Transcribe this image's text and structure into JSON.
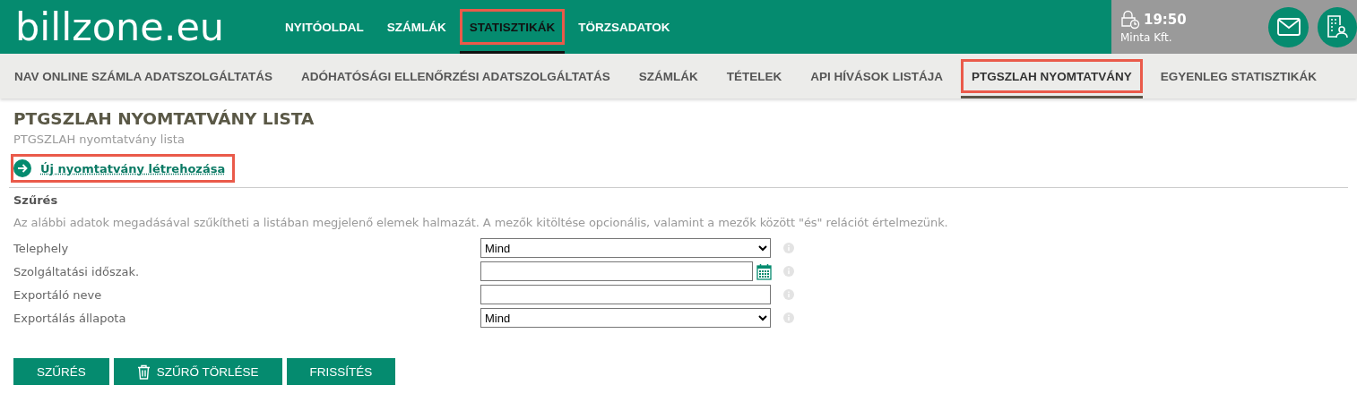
{
  "logo": "billzone.eu",
  "main_nav": [
    {
      "label": "NYITÓOLDAL",
      "selected": false,
      "highlighted": false
    },
    {
      "label": "SZÁMLÁK",
      "selected": false,
      "highlighted": false
    },
    {
      "label": "STATISZTIKÁK",
      "selected": true,
      "highlighted": true
    },
    {
      "label": "TÖRZSADATOK",
      "selected": false,
      "highlighted": false
    }
  ],
  "session": {
    "time": "19:50",
    "company": "Minta Kft."
  },
  "sub_nav": [
    {
      "label": "NAV ONLINE SZÁMLA ADATSZOLGÁLTATÁS",
      "selected": false,
      "highlighted": false
    },
    {
      "label": "ADÓHATÓSÁGI ELLENŐRZÉSI ADATSZOLGÁLTATÁS",
      "selected": false,
      "highlighted": false
    },
    {
      "label": "SZÁMLÁK",
      "selected": false,
      "highlighted": false
    },
    {
      "label": "TÉTELEK",
      "selected": false,
      "highlighted": false
    },
    {
      "label": "API HÍVÁSOK LISTÁJA",
      "selected": false,
      "highlighted": false
    },
    {
      "label": "PTGSZLAH NYOMTATVÁNY",
      "selected": true,
      "highlighted": true
    },
    {
      "label": "EGYENLEG STATISZTIKÁK",
      "selected": false,
      "highlighted": false
    }
  ],
  "page": {
    "title": "PTGSZLAH NYOMTATVÁNY LISTA",
    "subtitle": "PTGSZLAH nyomtatvány lista",
    "create_link": {
      "label": "Új nyomtatvány létrehozása",
      "highlighted": true
    }
  },
  "filter": {
    "title": "Szűrés",
    "description": "Az alábbi adatok megadásával szűkítheti a listában megjelenő elemek halmazát. A mezők kitöltése opcionális, valamint a mezők között \"és\" relációt értelmezünk.",
    "fields": [
      {
        "label": "Telephely",
        "kind": "select",
        "value": "Mind"
      },
      {
        "label": "Szolgáltatási időszak.",
        "kind": "date"
      },
      {
        "label": "Exportáló neve",
        "kind": "text"
      },
      {
        "label": "Exportálás állapota",
        "kind": "select",
        "value": "Mind"
      }
    ]
  },
  "buttons": [
    {
      "label": "SZŰRÉS",
      "kind": "plain"
    },
    {
      "label": "SZŰRŐ TÖRLÉSE",
      "kind": "trash"
    },
    {
      "label": "FRISSÍTÉS",
      "kind": "plain"
    }
  ]
}
